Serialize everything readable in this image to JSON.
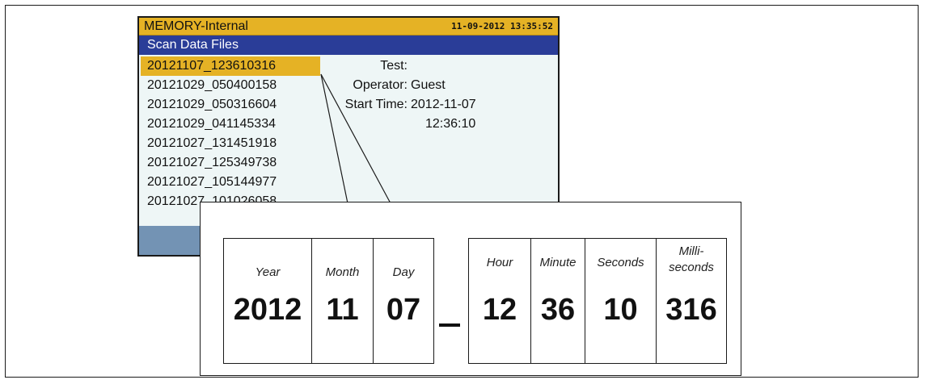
{
  "screen": {
    "title": "MEMORY-Internal",
    "datetime": "11-09-2012 13:35:52",
    "subtitle": "Scan Data Files",
    "files": [
      "20121107_123610316",
      "20121029_050400158",
      "20121029_050316604",
      "20121029_041145334",
      "20121027_131451918",
      "20121027_125349738",
      "20121027_105144977",
      "20121027_101026058"
    ],
    "selected_index": 0,
    "details": {
      "test_label": "Test:",
      "test_value": "",
      "operator_label": "Operator:",
      "operator_value": "Guest",
      "start_label": "Start Time:",
      "start_date": "2012-11-07",
      "start_time": "12:36:10"
    },
    "colors": {
      "title_bar": "#e5b225",
      "sub_bar": "#2a3d98",
      "selection": "#e5b225",
      "bottom_bar": "#7393b4",
      "background": "#eef6f6"
    }
  },
  "breakdown": {
    "year_label": "Year",
    "year_value": "2012",
    "month_label": "Month",
    "month_value": "11",
    "day_label": "Day",
    "day_value": "07",
    "separator": "_",
    "hour_label": "Hour",
    "hour_value": "12",
    "minute_label": "Minute",
    "minute_value": "36",
    "seconds_label": "Seconds",
    "seconds_value": "10",
    "ms_label_line1": "Milli-",
    "ms_label_line2": "seconds",
    "ms_value": "316"
  }
}
